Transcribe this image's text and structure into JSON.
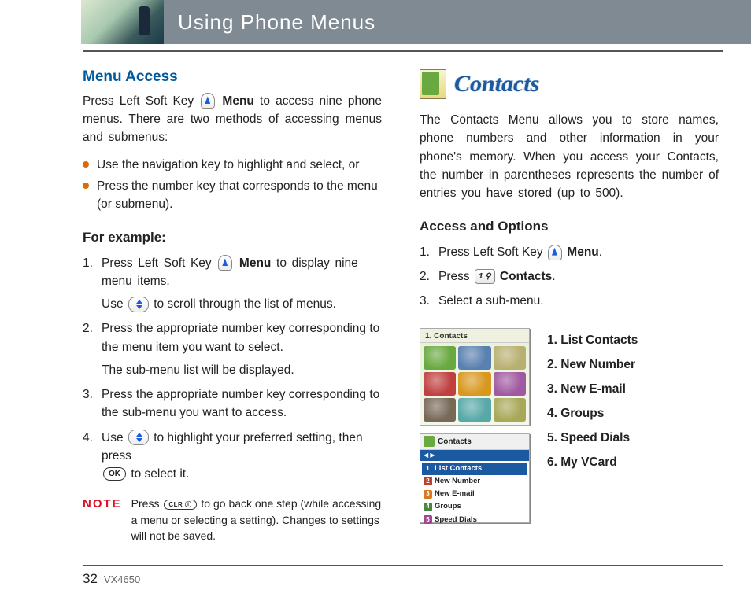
{
  "header": {
    "title": "Using Phone Menus"
  },
  "footer": {
    "page": "32",
    "model": "VX4650"
  },
  "left": {
    "h2": "Menu Access",
    "intro_a": "Press Left Soft Key ",
    "intro_b": " Menu",
    "intro_c": " to access nine phone menus. There are two methods of accessing menus and submenus:",
    "bullet1": "Use the navigation key to highlight and select, or",
    "bullet2": "Press the number key that corresponds to the menu (or submenu).",
    "example_h": "For example:",
    "s1a": "Press Left Soft Key ",
    "s1b": " Menu",
    "s1c": " to display nine menu items.",
    "s1d": "Use ",
    "s1e": " to scroll through the list of menus.",
    "s2a": "Press the appropriate number key corresponding to the menu item you want to select.",
    "s2b": "The sub-menu list will be displayed.",
    "s3": "Press the appropriate number key corresponding to the sub-menu you want to access.",
    "s4a": "Use ",
    "s4b": " to highlight your preferred setting, then press ",
    "s4c": " to select it.",
    "note_label": "NOTE",
    "note_a": "Press ",
    "note_b": " to go back one step (while accessing a menu or selecting a setting). Changes to settings will not be saved.",
    "ok": "OK",
    "clr": "CLR ⓘ"
  },
  "right": {
    "title": "Contacts",
    "intro": "The Contacts Menu allows you to store names, phone numbers and other information in your phone's memory. When you access your Contacts, the number in parentheses represents the number of entries you have stored (up to 500).",
    "h3": "Access and Options",
    "s1a": "Press Left Soft Key ",
    "s1b": " Menu",
    "s1c": ".",
    "s2a": "Press ",
    "s2b": " Contacts",
    "s2c": ".",
    "numkey": "1 ⚲",
    "s3": "Select a sub-menu.",
    "screen1_title": "1. Contacts",
    "screen2_title": "Contacts",
    "screen2_items": [
      "List Contacts",
      "New Number",
      "New E-mail",
      "Groups",
      "Speed Dials"
    ],
    "submenus": [
      "1. List Contacts",
      "2. New Number",
      "3. New E-mail",
      "4. Groups",
      "5. Speed Dials",
      "6. My VCard"
    ]
  }
}
